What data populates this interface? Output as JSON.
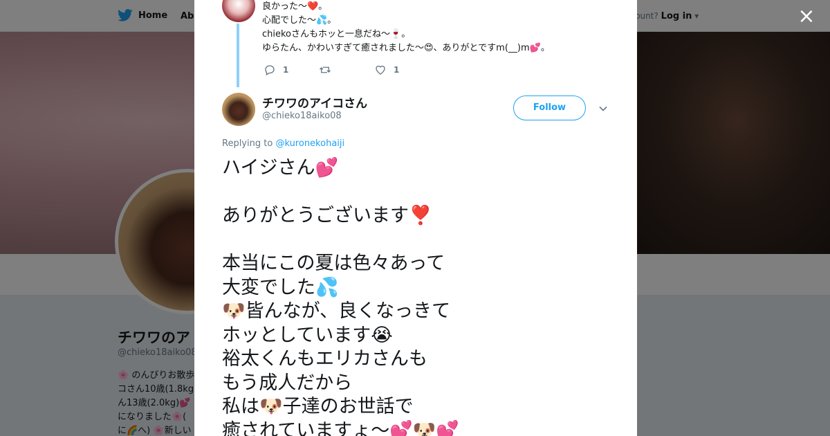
{
  "background": {
    "nav": {
      "home": "Home",
      "about": "Abo",
      "have_account": "ccount?",
      "login": "Log in"
    },
    "profile": {
      "name": "チワワのア",
      "handle": "@chieko18aiko08",
      "bio": "🌸 のんびりお散歩\nコさん10歳(1.8kg\nん13歳(2.0kg)💕\nになりました🌸(\nに🌈へ) 🌸新しい"
    }
  },
  "modal": {
    "close_label": "×",
    "previous_tweet": {
      "text": "良かった～❤️。\n心配でした～💦。\nchiekoさんもホッと一息だね～🍷。\nゆらたん、かわいすぎて癒されました～😍、ありがとですm(__)m💕。",
      "reply_count": "1",
      "retweet_count": "",
      "like_count": "1"
    },
    "tweet": {
      "display_name": "チワワのアイコさん",
      "handle": "@chieko18aiko08",
      "follow_label": "Follow",
      "replying_prefix": "Replying to ",
      "replying_to": "@kuronekohaiji",
      "text": "ハイジさん💕\n\nありがとうございます❣️\n\n本当にこの夏は色々あって\n大変でした💦\n🐶皆んなが、良くなっきて\nホッとしています😭\n裕太くんもエリカさんも\nもう成人だから\n私は🐶子達のお世話で\n癒されていますょ〜💕🐶💕"
    }
  },
  "colors": {
    "accent": "#1da1f2",
    "thread_line": "#8ed0f9",
    "text": "#14171a",
    "muted": "#657786"
  }
}
